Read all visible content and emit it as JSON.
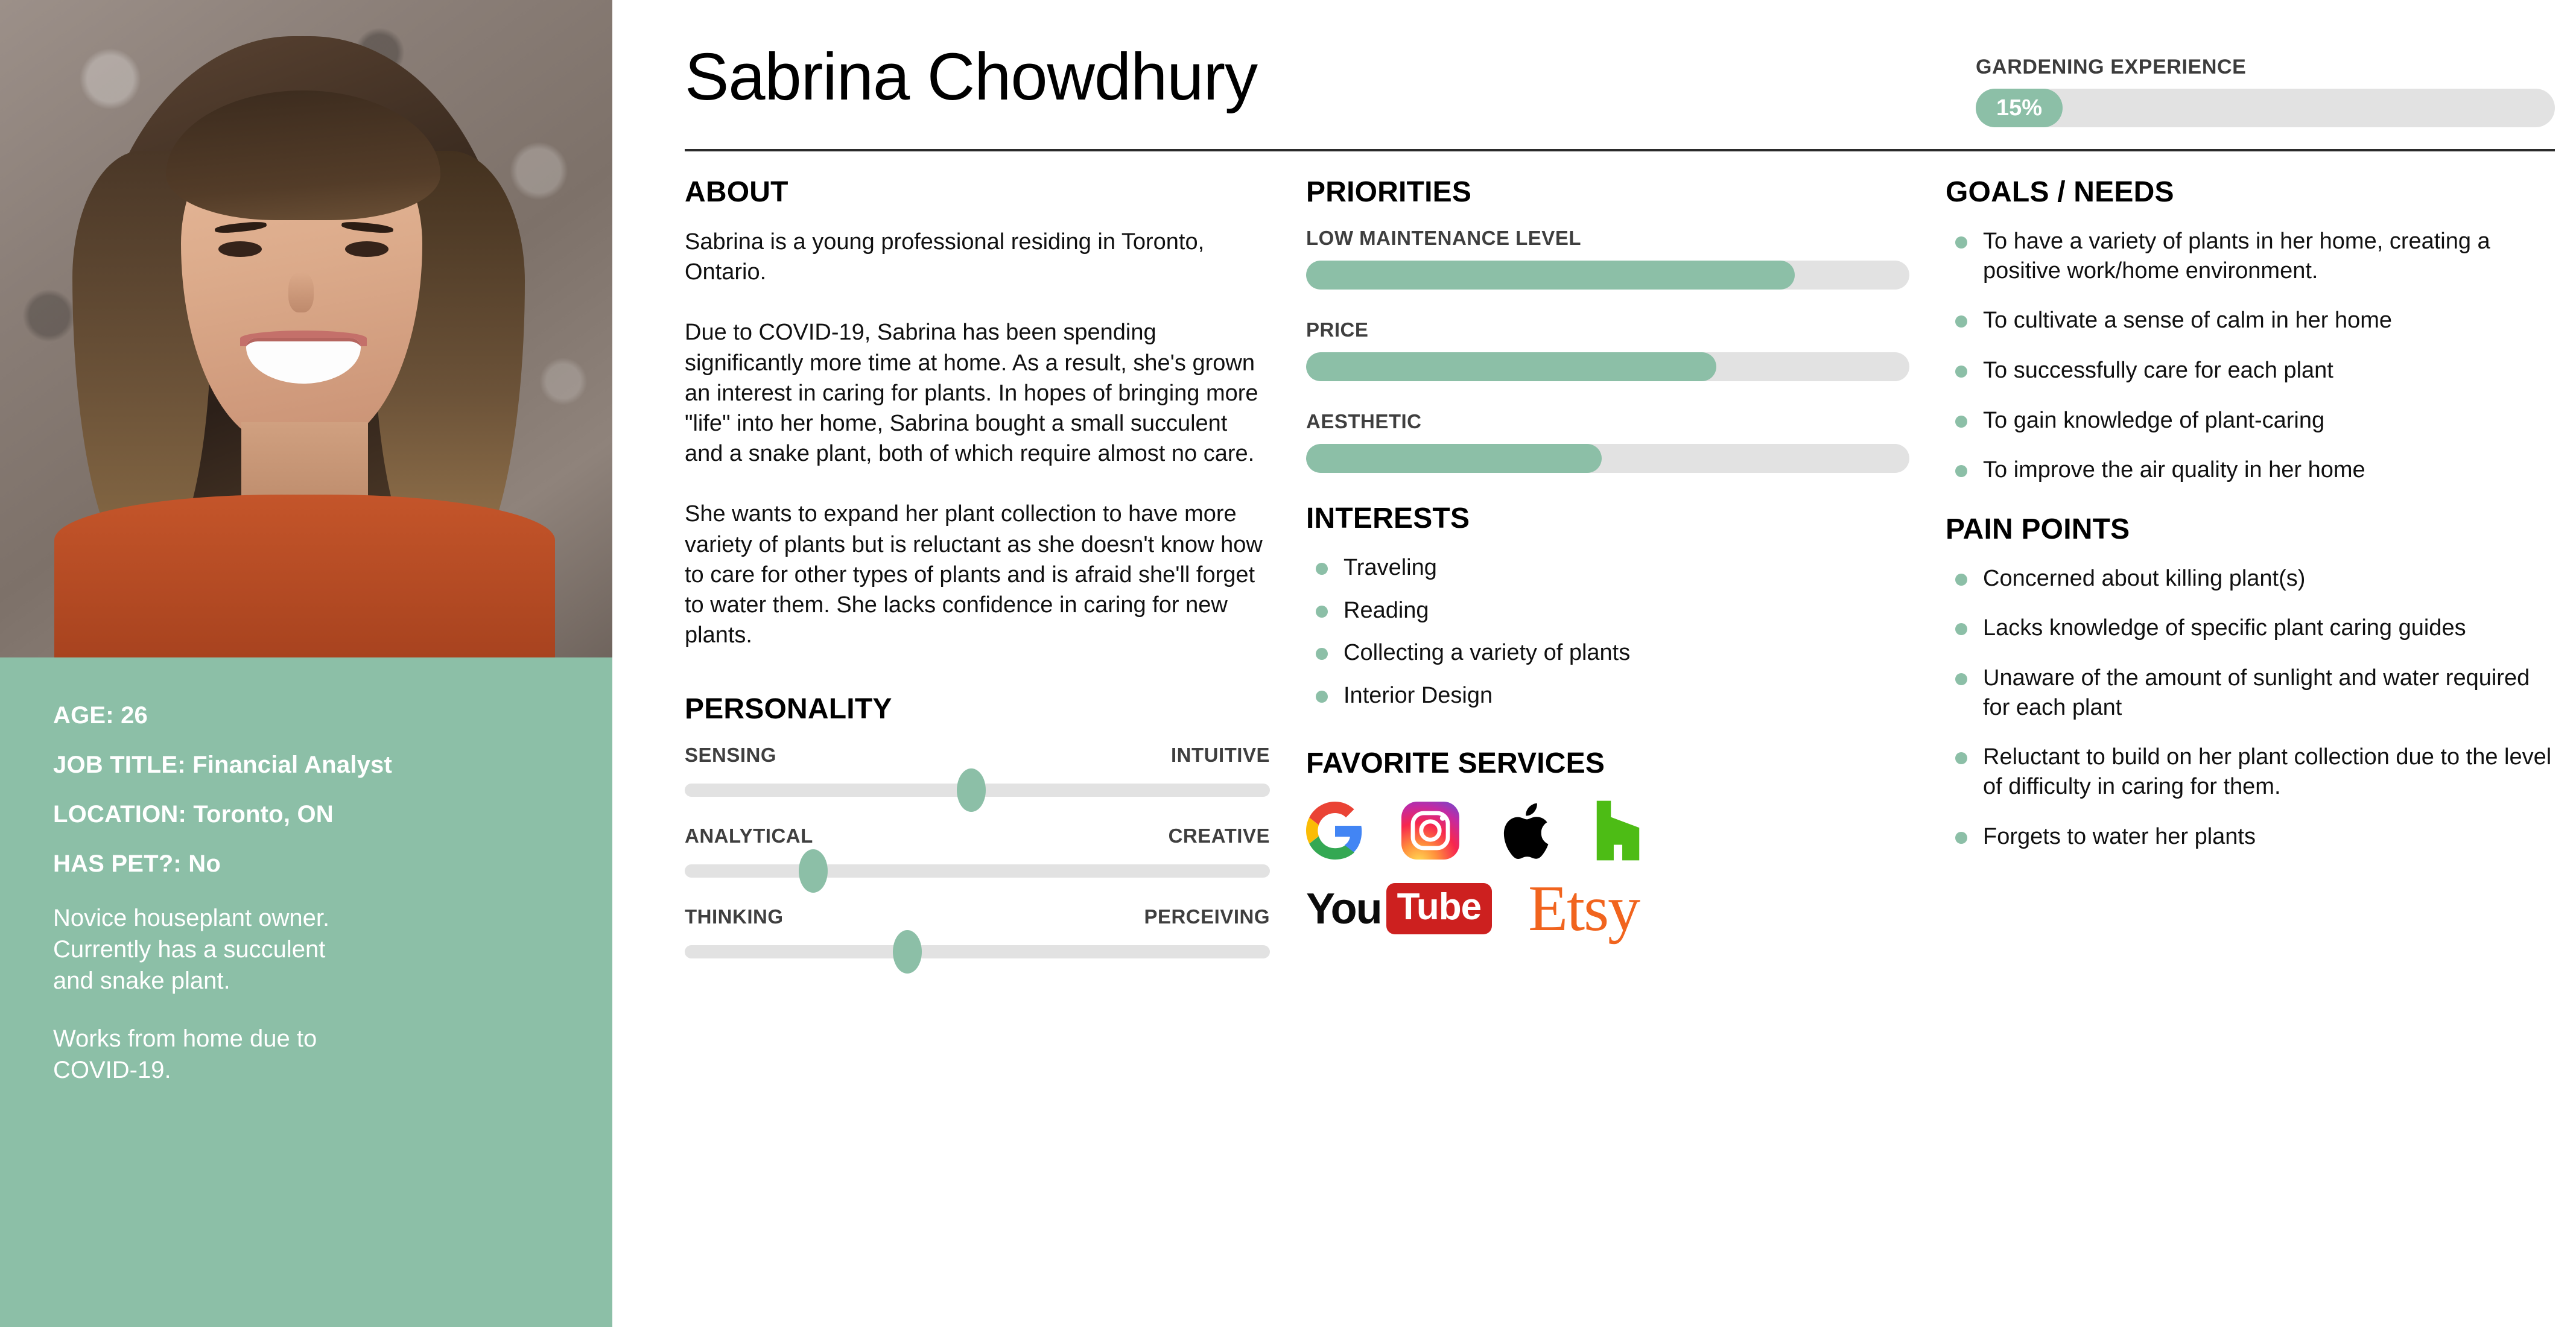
{
  "colors": {
    "accent_green": "#8cbfa7",
    "track_gray": "#e2e2e2",
    "text_dark": "#111111",
    "label_gray": "#3f3f3f"
  },
  "person": {
    "name": "Sabrina Chowdhury",
    "photo_alt": "smiling-woman-portrait"
  },
  "experience": {
    "label": "GARDENING EXPERIENCE",
    "percent_text": "15%",
    "percent": 15
  },
  "bio": {
    "age_label": "AGE: 26",
    "job_label": "JOB TITLE: Financial Analyst",
    "location_label": "LOCATION: Toronto, ON",
    "pet_label": " HAS PET?: No",
    "note_1": "Novice houseplant owner.\nCurrently has a succulent\nand snake plant.",
    "note_2": "Works from home due to\nCOVID-19."
  },
  "about": {
    "title": "ABOUT",
    "paragraphs": "Sabrina is a young professional residing in Toronto, Ontario.\n\nDue to COVID-19, Sabrina has been spending significantly more time at home. As a result, she's grown an interest in caring for plants.  In hopes of bringing more \"life\" into her home, Sabrina bought a small succulent and a snake plant, both of which require almost no care.\n\nShe wants to expand her plant collection to have more variety of plants but is reluctant as she doesn't know how to care for other types of plants and is afraid she'll forget to water them. She lacks confidence in caring for new plants."
  },
  "personality": {
    "title": "PERSONALITY",
    "rows": [
      {
        "left": "SENSING",
        "right": "INTUITIVE",
        "value": 49
      },
      {
        "left": "ANALYTICAL",
        "right": "CREATIVE",
        "value": 22
      },
      {
        "left": "THINKING",
        "right": "PERCEIVING",
        "value": 38
      }
    ]
  },
  "priorities": {
    "title": "PRIORITIES",
    "items": [
      {
        "label": "LOW MAINTENANCE LEVEL",
        "value": 81
      },
      {
        "label": "PRICE",
        "value": 68
      },
      {
        "label": "AESTHETIC",
        "value": 49
      }
    ]
  },
  "interests": {
    "title": "INTERESTS",
    "items": [
      "Traveling",
      "Reading",
      "Collecting a variety of plants",
      "Interior Design"
    ]
  },
  "favorite_services": {
    "title": "FAVORITE SERVICES",
    "items": [
      {
        "name": "google-logo",
        "label": "Google"
      },
      {
        "name": "instagram-logo",
        "label": "Instagram"
      },
      {
        "name": "apple-logo",
        "label": "Apple"
      },
      {
        "name": "houzz-logo",
        "label": "Houzz"
      },
      {
        "name": "youtube-logo",
        "label": "YouTube"
      },
      {
        "name": "etsy-logo",
        "label": "Etsy"
      }
    ],
    "youtube_you": "You",
    "youtube_tube": "Tube",
    "etsy_text": "Etsy"
  },
  "goals": {
    "title": "GOALS / NEEDS",
    "items": [
      "To have a variety of plants in her home, creating a positive work/home environment.",
      "To cultivate a sense of calm in her home",
      "To successfully care for each plant",
      "To gain knowledge of plant-caring",
      "To improve the air quality in her home"
    ]
  },
  "pain_points": {
    "title": "PAIN POINTS",
    "items": [
      " Concerned about killing plant(s)",
      "Lacks knowledge of specific plant caring guides",
      " Unaware of the amount of sunlight and water required for each plant",
      "Reluctant to build on her plant collection due to the level of difficulty in caring for them.",
      " Forgets to water her plants"
    ]
  }
}
